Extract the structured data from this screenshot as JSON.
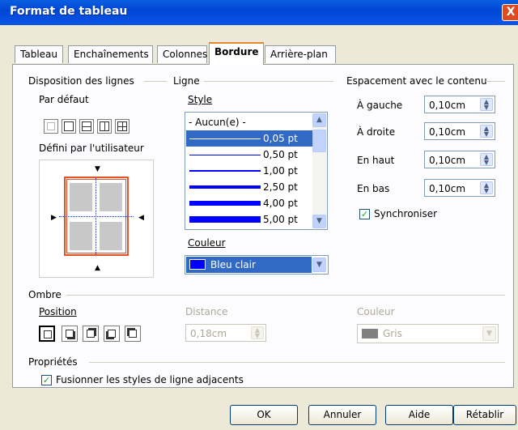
{
  "window": {
    "title": "Format de tableau",
    "close_glyph": "X"
  },
  "tabs": [
    {
      "label": "Tableau"
    },
    {
      "label": "Enchaînements"
    },
    {
      "label": "Colonnes"
    },
    {
      "label": "Bordure"
    },
    {
      "label": "Arrière-plan"
    }
  ],
  "active_tab": "Bordure",
  "line_arrangement": {
    "section_label": "Disposition des lignes",
    "default_label": "Par défaut",
    "user_defined_label": "Défini par l'utilisateur"
  },
  "line": {
    "section_label": "Ligne",
    "style_label": "Style",
    "style_options": [
      "- Aucun(e) -",
      "0,05 pt",
      "0,50 pt",
      "1,00 pt",
      "2,50 pt",
      "4,00 pt",
      "5,00 pt"
    ],
    "selected_style": "0,05 pt",
    "color_label": "Couleur",
    "color_value": "Bleu clair",
    "color_swatch": "#0000ff"
  },
  "spacing": {
    "section_label": "Espacement avec le contenu",
    "left_label": "À gauche",
    "left_value": "0,10cm",
    "right_label": "À droite",
    "right_value": "0,10cm",
    "top_label": "En haut",
    "top_value": "0,10cm",
    "bottom_label": "En bas",
    "bottom_value": "0,10cm",
    "sync_label": "Synchroniser",
    "sync_checked": true
  },
  "shadow": {
    "section_label": "Ombre",
    "position_label": "Position",
    "distance_label": "Distance",
    "distance_value": "0,18cm",
    "color_label": "Couleur",
    "color_value": "Gris",
    "color_swatch": "#808080"
  },
  "properties": {
    "section_label": "Propriétés",
    "merge_label": "Fusionner les styles de ligne adjacents",
    "merge_checked": true
  },
  "buttons": {
    "ok": "OK",
    "cancel": "Annuler",
    "help": "Aide",
    "reset": "Rétablir"
  }
}
